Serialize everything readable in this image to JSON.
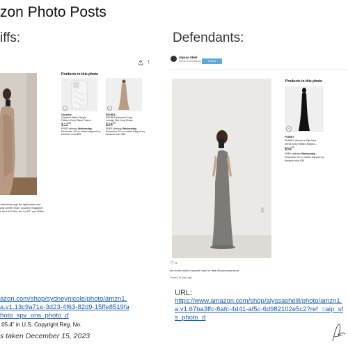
{
  "slide": {
    "title": "zon Photo Posts",
    "plaintiffs_heading": "iffs:",
    "defendants_heading": "Defendants:",
    "photos_taken": "s taken December 15, 2023"
  },
  "plaintiff": {
    "products_heading": "Products in this photo",
    "products": [
      {
        "brand": "Casetive",
        "title_line1": "Casetive Water Ripple",
        "title_line2": "Pattern Curly Wave Frame...",
        "price": "$12",
        "price_cents": "99",
        "delivery_label": "FREE delivery",
        "delivery_day": "Wednesday,",
        "delivery_line2": "December 20 on orders shipped by",
        "delivery_line3": "Amazon over $35"
      },
      {
        "brand": "REORIA",
        "title_line1": "REORIA Women's Sexy",
        "title_line2": "Lounge Slip Long Dress...",
        "price": "$34",
        "price_cents": "99",
        "delivery_label": "FREE delivery",
        "delivery_day": "Wednesday,",
        "delivery_line2": "December 20 on orders shipped by",
        "delivery_line3": "Amazon over $35"
      }
    ],
    "caption_line1": "l this dress hugs the right places and",
    "caption_line2": "way comfier than I would've imagined!!",
    "caption_line3": "k too 10/10 Size ref: I'm 5'2\" and 115lbs",
    "url_line1": "azon.com/shop/sydneynicole/photo/amzn1.",
    "url_line2": "a.v1.13c9a71e-3d23-4f63-82d9-15ffe8519fa",
    "url_line3": "hoto_spv_ons_photo_d",
    "reg_text": ".05.4\" in U.S. Copyright Reg. No."
  },
  "defendant": {
    "account_name": "Alyssa Sheil",
    "account_sub": "Earns Commissions",
    "follow_label": "Follow",
    "products_heading": "Products in this photo",
    "product": {
      "brand": "PUMIEY",
      "title_line1": "PUMIEY Women's Slip Maxi",
      "title_line2": "Dress Sexy Ribbed Bodyco...",
      "price": "$54",
      "price_cents": "99",
      "delivery_label": "FREE delivery",
      "delivery_day": "Wednesday,",
      "delivery_line2": "December 20 on orders shipped by",
      "delivery_line3": "Amazon over $35"
    },
    "likes": "5",
    "caption": "the iconic skims inspired maxi on deal #foundonamazon",
    "posted": "Posted 18 days ago",
    "url_label": "URL:",
    "url_line1": "https://www.amazon.com/shop/alyssasheill/photo/amzn1.",
    "url_line2": "a.v1.67ba3ffc-8afc-4d41-af5c-6d982102e5c2?ref_=aip_sf",
    "url_line3": "s_photo_d"
  }
}
